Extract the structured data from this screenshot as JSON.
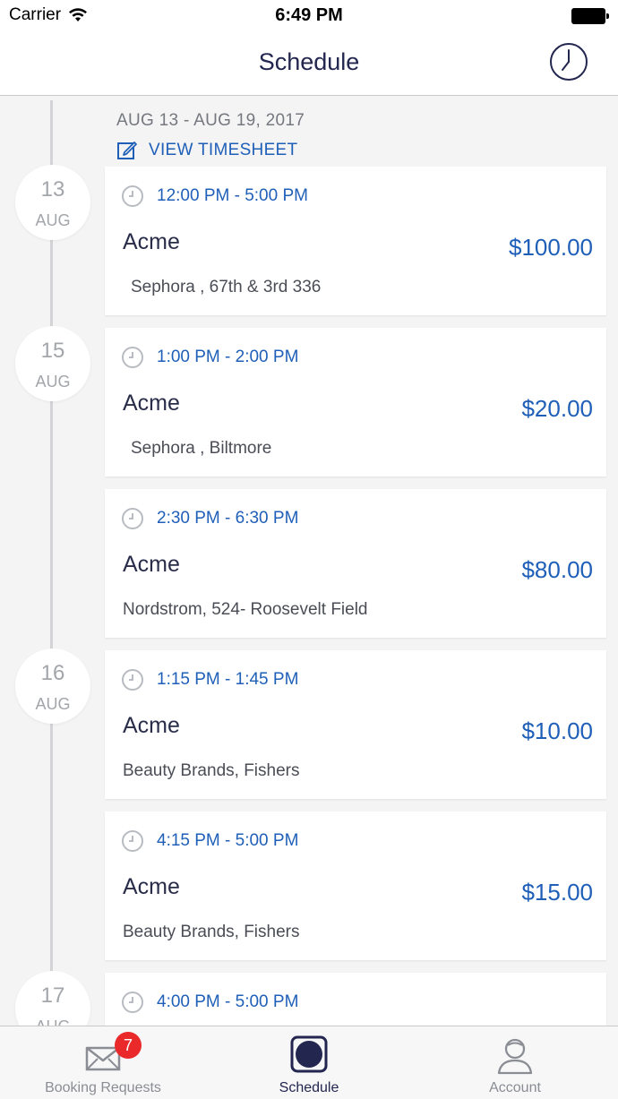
{
  "status_bar": {
    "carrier": "Carrier",
    "time": "6:49 PM"
  },
  "nav": {
    "title": "Schedule",
    "right_icon": "clock-icon"
  },
  "week": {
    "range": "AUG 13  - AUG 19, 2017",
    "timesheet_label": "VIEW TIMESHEET"
  },
  "dates": [
    {
      "day": "13",
      "month": "AUG"
    },
    {
      "day": "15",
      "month": "AUG"
    },
    {
      "day": "16",
      "month": "AUG"
    },
    {
      "day": "17",
      "month": "AUG"
    }
  ],
  "shifts": [
    {
      "time": "12:00 PM - 5:00 PM",
      "client": "Acme",
      "amount": "$100.00",
      "location": "Sephora , 67th & 3rd 336"
    },
    {
      "time": "1:00 PM - 2:00 PM",
      "client": "Acme",
      "amount": "$20.00",
      "location": "Sephora , Biltmore"
    },
    {
      "time": "2:30 PM - 6:30 PM",
      "client": "Acme",
      "amount": "$80.00",
      "location": "Nordstrom, 524- Roosevelt Field"
    },
    {
      "time": "1:15 PM - 1:45 PM",
      "client": "Acme",
      "amount": "$10.00",
      "location": "Beauty Brands, Fishers"
    },
    {
      "time": "4:15 PM - 5:00 PM",
      "client": "Acme",
      "amount": "$15.00",
      "location": "Beauty Brands, Fishers"
    },
    {
      "time": "4:00 PM - 5:00 PM",
      "client": "",
      "amount": "",
      "location": ""
    }
  ],
  "tabs": [
    {
      "label": "Booking Requests",
      "icon": "mail-icon",
      "badge": "7"
    },
    {
      "label": "Schedule",
      "icon": "schedule-icon",
      "active": true
    },
    {
      "label": "Account",
      "icon": "user-icon"
    }
  ],
  "colors": {
    "accent": "#1f5fb8",
    "navy": "#23264f",
    "badge": "#ea2a2a"
  }
}
